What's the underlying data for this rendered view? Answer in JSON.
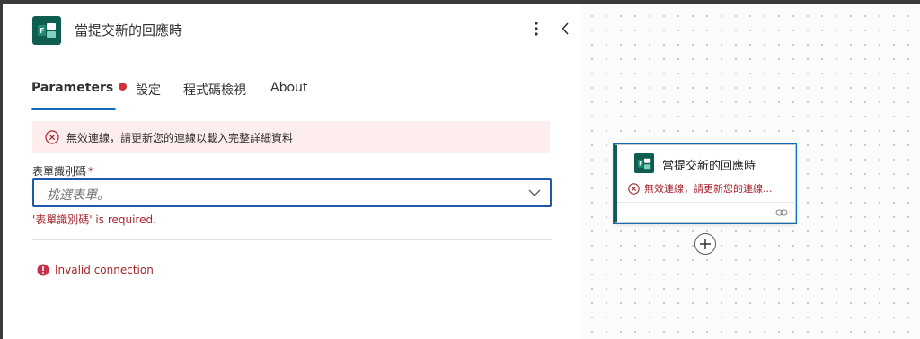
{
  "panel": {
    "title": "當提交新的回應時",
    "more_icon": "more-vertical-icon",
    "collapse_icon": "chevron-left-icon",
    "tabs": [
      {
        "label": "Parameters",
        "active": true,
        "has_error_dot": true
      },
      {
        "label": "設定"
      },
      {
        "label": "程式碼檢視"
      },
      {
        "label": "About"
      }
    ],
    "error_banner": {
      "icon": "error-circle-icon",
      "message": "無效連線，請更新您的連線以載入完整詳細資料"
    },
    "field": {
      "label": "表單識別碼",
      "required_marker": "*",
      "placeholder": "挑選表單。",
      "error": "'表單識別碼' is required."
    },
    "invalid_connection": "Invalid connection"
  },
  "canvas": {
    "node": {
      "title": "當提交新的回應時",
      "error": "無效連線，請更新您的連線..."
    }
  },
  "colors": {
    "accent": "#0f6cbd",
    "forms_teal": "#0f5d51",
    "error_red": "#a4262c",
    "error_bg": "#fdeeed"
  }
}
